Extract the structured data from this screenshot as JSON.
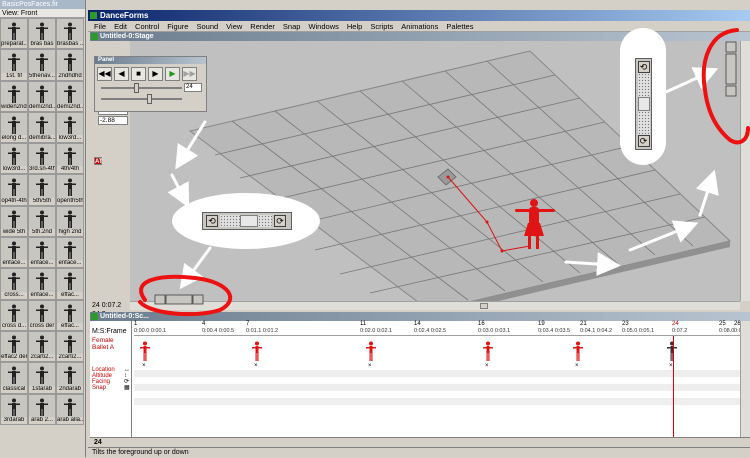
{
  "palette": {
    "title": "BasicPosFaces.fir",
    "view_label": "View: Front",
    "poses": [
      "preparat...",
      "bras bas",
      "brasbas ...",
      "1st. fif",
      "5thenav...",
      "2ndhdhd",
      "widen2nd...",
      "demi2nd...",
      "demi2nd...",
      "elong d...",
      "demibra...",
      "low3rd...",
      "low3rd...",
      "3rd.sn-4th",
      "4th/4th",
      "op4th-4th",
      "5th/5th",
      "openth5th",
      "wide 5th",
      "5th.2nd",
      "high 2nd",
      "enface...",
      "enface...",
      "enface...",
      "cross...",
      "enface...",
      "effac...",
      "cross d...",
      "cross der",
      "effac...",
      "effac2 der",
      "2carti2...",
      "2carti2...",
      "classical",
      "1starab",
      "2ndarab",
      "3rdarab",
      "arab 2...",
      "arab alla..."
    ]
  },
  "app": {
    "title": "DanceForms",
    "menu": [
      "File",
      "Edit",
      "Control",
      "Figure",
      "Sound",
      "View",
      "Render",
      "Snap",
      "Windows",
      "Help",
      "Scripts",
      "Animations",
      "Palettes"
    ]
  },
  "stage": {
    "title": "Untitled-0:Stage",
    "field_1": "1-05",
    "field_2": "-2.88",
    "footer": "24 0:07.2 24.2",
    "at_label": "AT"
  },
  "panel": {
    "title": "Panel",
    "buttons": [
      {
        "name": "rewind-button",
        "glyph": "◀◀"
      },
      {
        "name": "step-back-button",
        "glyph": "◀"
      },
      {
        "name": "stop-button",
        "glyph": "■"
      },
      {
        "name": "step-forward-button",
        "glyph": "▶"
      },
      {
        "name": "play-button",
        "glyph": "▶"
      },
      {
        "name": "fast-forward-button",
        "glyph": "▶▶"
      }
    ],
    "frame_value": "24",
    "speed_fraction": 0.4,
    "tempo_fraction": 0.55
  },
  "timeline": {
    "title": "Untitled-0:Sc...",
    "row_label": "M:S:Frame",
    "figure_name": "Female Ballet A",
    "tracks": [
      "Location",
      "Altitude",
      "Facing",
      "Snap"
    ],
    "frames": [
      {
        "n": "1",
        "t": "0:00.0 0:00.1"
      },
      {
        "n": "4",
        "t": "0:00.4 0:00.5"
      },
      {
        "n": "7",
        "t": "0:01.1 0:01.2"
      },
      {
        "n": "11",
        "t": "0:02.0 0:02.1"
      },
      {
        "n": "14",
        "t": "0:02.4 0:02.5"
      },
      {
        "n": "16",
        "t": "0:03.0 0:03.1"
      },
      {
        "n": "19",
        "t": "0:03.4 0:03.5"
      },
      {
        "n": "21",
        "t": "0:04.1 0:04.2"
      },
      {
        "n": "23",
        "t": "0:05.0 0:05.1"
      },
      {
        "n": "24",
        "t": "0:07.2"
      },
      {
        "n": "25",
        "t": "0:08.0"
      },
      {
        "n": "26",
        "t": "0:08.1"
      }
    ],
    "current_frame": "24",
    "footer_frame": "24"
  },
  "status": {
    "text": "Tilts the foreground up or down"
  },
  "colors": {
    "accent_red": "#dd1111",
    "title_blue": "#0a246a",
    "green_icon": "#1c9a1c"
  }
}
